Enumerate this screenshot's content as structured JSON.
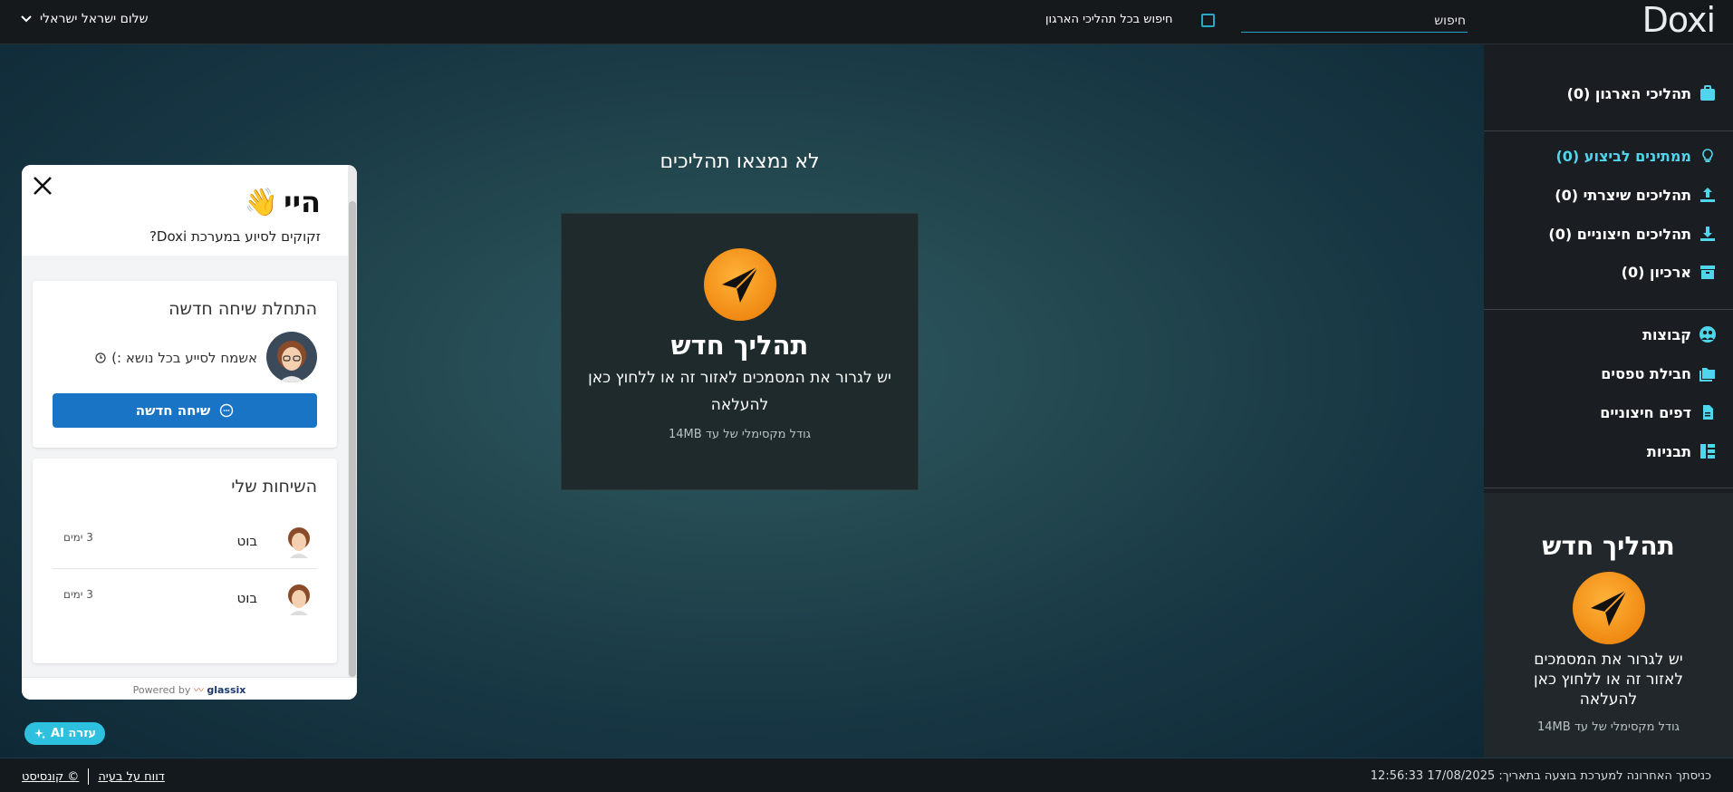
{
  "header": {
    "logo_text": "Doxi",
    "search_placeholder": "חיפוש",
    "search_all_label": "חיפוש בכל תהליכי הארגון",
    "user_greeting": "שלום ישראל ישראלי"
  },
  "main": {
    "empty_title": "לא נמצאו תהליכים",
    "upload": {
      "title": "תהליך חדש",
      "description": "יש לגרור את המסמכים לאזור זה או ללחוץ כאן להעלאה",
      "max_size": "גודל מקסימלי של עד 14MB"
    }
  },
  "sidebar": {
    "items": [
      {
        "label": "תהליכי הארגון (0)",
        "icon": "briefcase-icon"
      },
      {
        "label": "ממתינים לביצוע (0)",
        "icon": "lightbulb-icon",
        "active": true
      },
      {
        "label": "תהליכים שיצרתי (0)",
        "icon": "upload-icon"
      },
      {
        "label": "תהליכים חיצוניים (0)",
        "icon": "download-icon"
      },
      {
        "label": "ארכיון (0)",
        "icon": "archive-icon"
      },
      {
        "label": "קבוצות",
        "icon": "users-icon"
      },
      {
        "label": "חבילת טפסים",
        "icon": "folders-icon"
      },
      {
        "label": "דפים חיצוניים",
        "icon": "document-icon"
      },
      {
        "label": "תבניות",
        "icon": "template-icon"
      }
    ],
    "new_process": {
      "title": "תהליך חדש",
      "description": "יש לגרור את המסמכים לאזור זה או ללחוץ כאן להעלאה",
      "max_size": "גודל מקסימלי של עד 14MB"
    }
  },
  "chat": {
    "greeting": "היי",
    "subtitle": "זקוקים לסיוע במערכת Doxi?",
    "start_title": "התחלת שיחה חדשה",
    "status": "אשמח לסייע בכל נושא :)",
    "new_chat_button": "שיחה חדשה",
    "my_chats_title": "השיחות שלי",
    "conversations": [
      {
        "name": "בוט",
        "time": "3 ימים"
      },
      {
        "name": "בוט",
        "time": "3 ימים"
      }
    ],
    "powered_by": "Powered by",
    "powered_brand": "glassix"
  },
  "ai_help_label": "עזרה AI",
  "footer": {
    "report_label": "דווח על בעיה",
    "brand_label": "© קונסיסט",
    "last_login": "כניסתך האחרונה למערכת בוצעה בתאריך: 17/08/2025 12:56:33"
  },
  "colors": {
    "accent": "#2aa6c9",
    "active": "#4fd6ec",
    "orange": "#f08a13",
    "button_blue": "#1a74c6"
  }
}
